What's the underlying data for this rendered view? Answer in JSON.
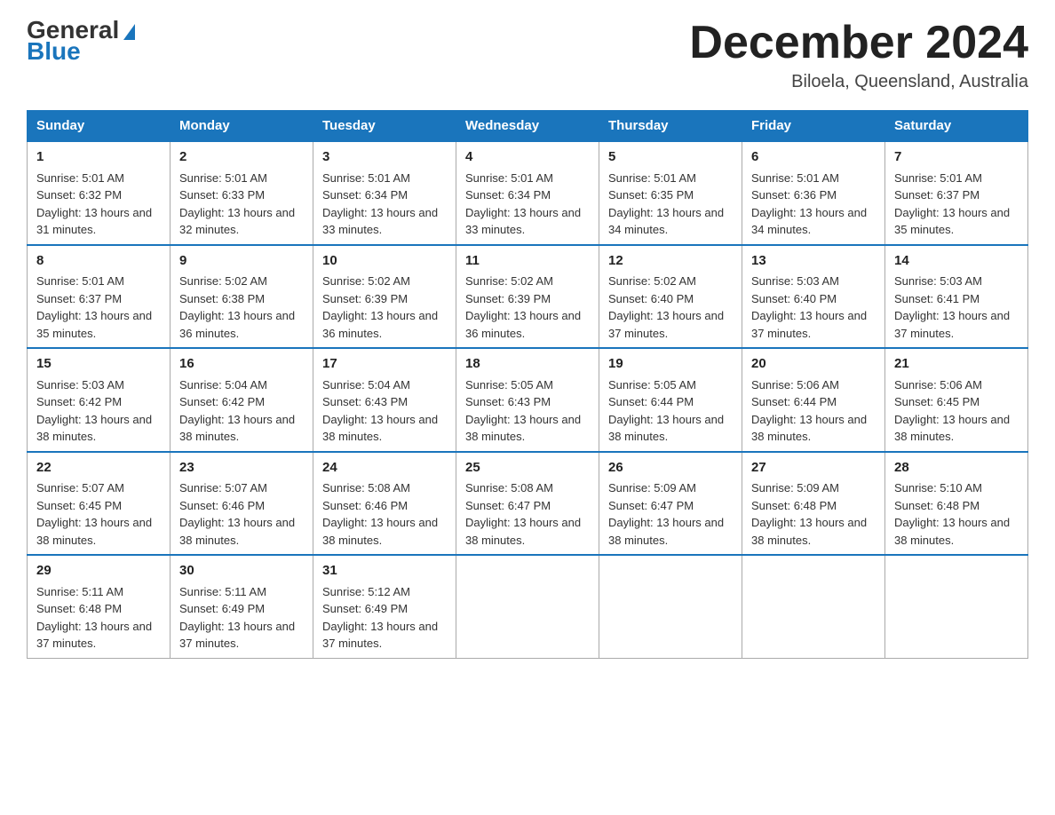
{
  "header": {
    "logo_general": "General",
    "logo_blue": "Blue",
    "month_title": "December 2024",
    "location": "Biloela, Queensland, Australia"
  },
  "days_of_week": [
    "Sunday",
    "Monday",
    "Tuesday",
    "Wednesday",
    "Thursday",
    "Friday",
    "Saturday"
  ],
  "weeks": [
    [
      {
        "day": "1",
        "sunrise": "5:01 AM",
        "sunset": "6:32 PM",
        "daylight": "13 hours and 31 minutes."
      },
      {
        "day": "2",
        "sunrise": "5:01 AM",
        "sunset": "6:33 PM",
        "daylight": "13 hours and 32 minutes."
      },
      {
        "day": "3",
        "sunrise": "5:01 AM",
        "sunset": "6:34 PM",
        "daylight": "13 hours and 33 minutes."
      },
      {
        "day": "4",
        "sunrise": "5:01 AM",
        "sunset": "6:34 PM",
        "daylight": "13 hours and 33 minutes."
      },
      {
        "day": "5",
        "sunrise": "5:01 AM",
        "sunset": "6:35 PM",
        "daylight": "13 hours and 34 minutes."
      },
      {
        "day": "6",
        "sunrise": "5:01 AM",
        "sunset": "6:36 PM",
        "daylight": "13 hours and 34 minutes."
      },
      {
        "day": "7",
        "sunrise": "5:01 AM",
        "sunset": "6:37 PM",
        "daylight": "13 hours and 35 minutes."
      }
    ],
    [
      {
        "day": "8",
        "sunrise": "5:01 AM",
        "sunset": "6:37 PM",
        "daylight": "13 hours and 35 minutes."
      },
      {
        "day": "9",
        "sunrise": "5:02 AM",
        "sunset": "6:38 PM",
        "daylight": "13 hours and 36 minutes."
      },
      {
        "day": "10",
        "sunrise": "5:02 AM",
        "sunset": "6:39 PM",
        "daylight": "13 hours and 36 minutes."
      },
      {
        "day": "11",
        "sunrise": "5:02 AM",
        "sunset": "6:39 PM",
        "daylight": "13 hours and 36 minutes."
      },
      {
        "day": "12",
        "sunrise": "5:02 AM",
        "sunset": "6:40 PM",
        "daylight": "13 hours and 37 minutes."
      },
      {
        "day": "13",
        "sunrise": "5:03 AM",
        "sunset": "6:40 PM",
        "daylight": "13 hours and 37 minutes."
      },
      {
        "day": "14",
        "sunrise": "5:03 AM",
        "sunset": "6:41 PM",
        "daylight": "13 hours and 37 minutes."
      }
    ],
    [
      {
        "day": "15",
        "sunrise": "5:03 AM",
        "sunset": "6:42 PM",
        "daylight": "13 hours and 38 minutes."
      },
      {
        "day": "16",
        "sunrise": "5:04 AM",
        "sunset": "6:42 PM",
        "daylight": "13 hours and 38 minutes."
      },
      {
        "day": "17",
        "sunrise": "5:04 AM",
        "sunset": "6:43 PM",
        "daylight": "13 hours and 38 minutes."
      },
      {
        "day": "18",
        "sunrise": "5:05 AM",
        "sunset": "6:43 PM",
        "daylight": "13 hours and 38 minutes."
      },
      {
        "day": "19",
        "sunrise": "5:05 AM",
        "sunset": "6:44 PM",
        "daylight": "13 hours and 38 minutes."
      },
      {
        "day": "20",
        "sunrise": "5:06 AM",
        "sunset": "6:44 PM",
        "daylight": "13 hours and 38 minutes."
      },
      {
        "day": "21",
        "sunrise": "5:06 AM",
        "sunset": "6:45 PM",
        "daylight": "13 hours and 38 minutes."
      }
    ],
    [
      {
        "day": "22",
        "sunrise": "5:07 AM",
        "sunset": "6:45 PM",
        "daylight": "13 hours and 38 minutes."
      },
      {
        "day": "23",
        "sunrise": "5:07 AM",
        "sunset": "6:46 PM",
        "daylight": "13 hours and 38 minutes."
      },
      {
        "day": "24",
        "sunrise": "5:08 AM",
        "sunset": "6:46 PM",
        "daylight": "13 hours and 38 minutes."
      },
      {
        "day": "25",
        "sunrise": "5:08 AM",
        "sunset": "6:47 PM",
        "daylight": "13 hours and 38 minutes."
      },
      {
        "day": "26",
        "sunrise": "5:09 AM",
        "sunset": "6:47 PM",
        "daylight": "13 hours and 38 minutes."
      },
      {
        "day": "27",
        "sunrise": "5:09 AM",
        "sunset": "6:48 PM",
        "daylight": "13 hours and 38 minutes."
      },
      {
        "day": "28",
        "sunrise": "5:10 AM",
        "sunset": "6:48 PM",
        "daylight": "13 hours and 38 minutes."
      }
    ],
    [
      {
        "day": "29",
        "sunrise": "5:11 AM",
        "sunset": "6:48 PM",
        "daylight": "13 hours and 37 minutes."
      },
      {
        "day": "30",
        "sunrise": "5:11 AM",
        "sunset": "6:49 PM",
        "daylight": "13 hours and 37 minutes."
      },
      {
        "day": "31",
        "sunrise": "5:12 AM",
        "sunset": "6:49 PM",
        "daylight": "13 hours and 37 minutes."
      },
      null,
      null,
      null,
      null
    ]
  ],
  "labels": {
    "sunrise": "Sunrise:",
    "sunset": "Sunset:",
    "daylight": "Daylight:"
  }
}
